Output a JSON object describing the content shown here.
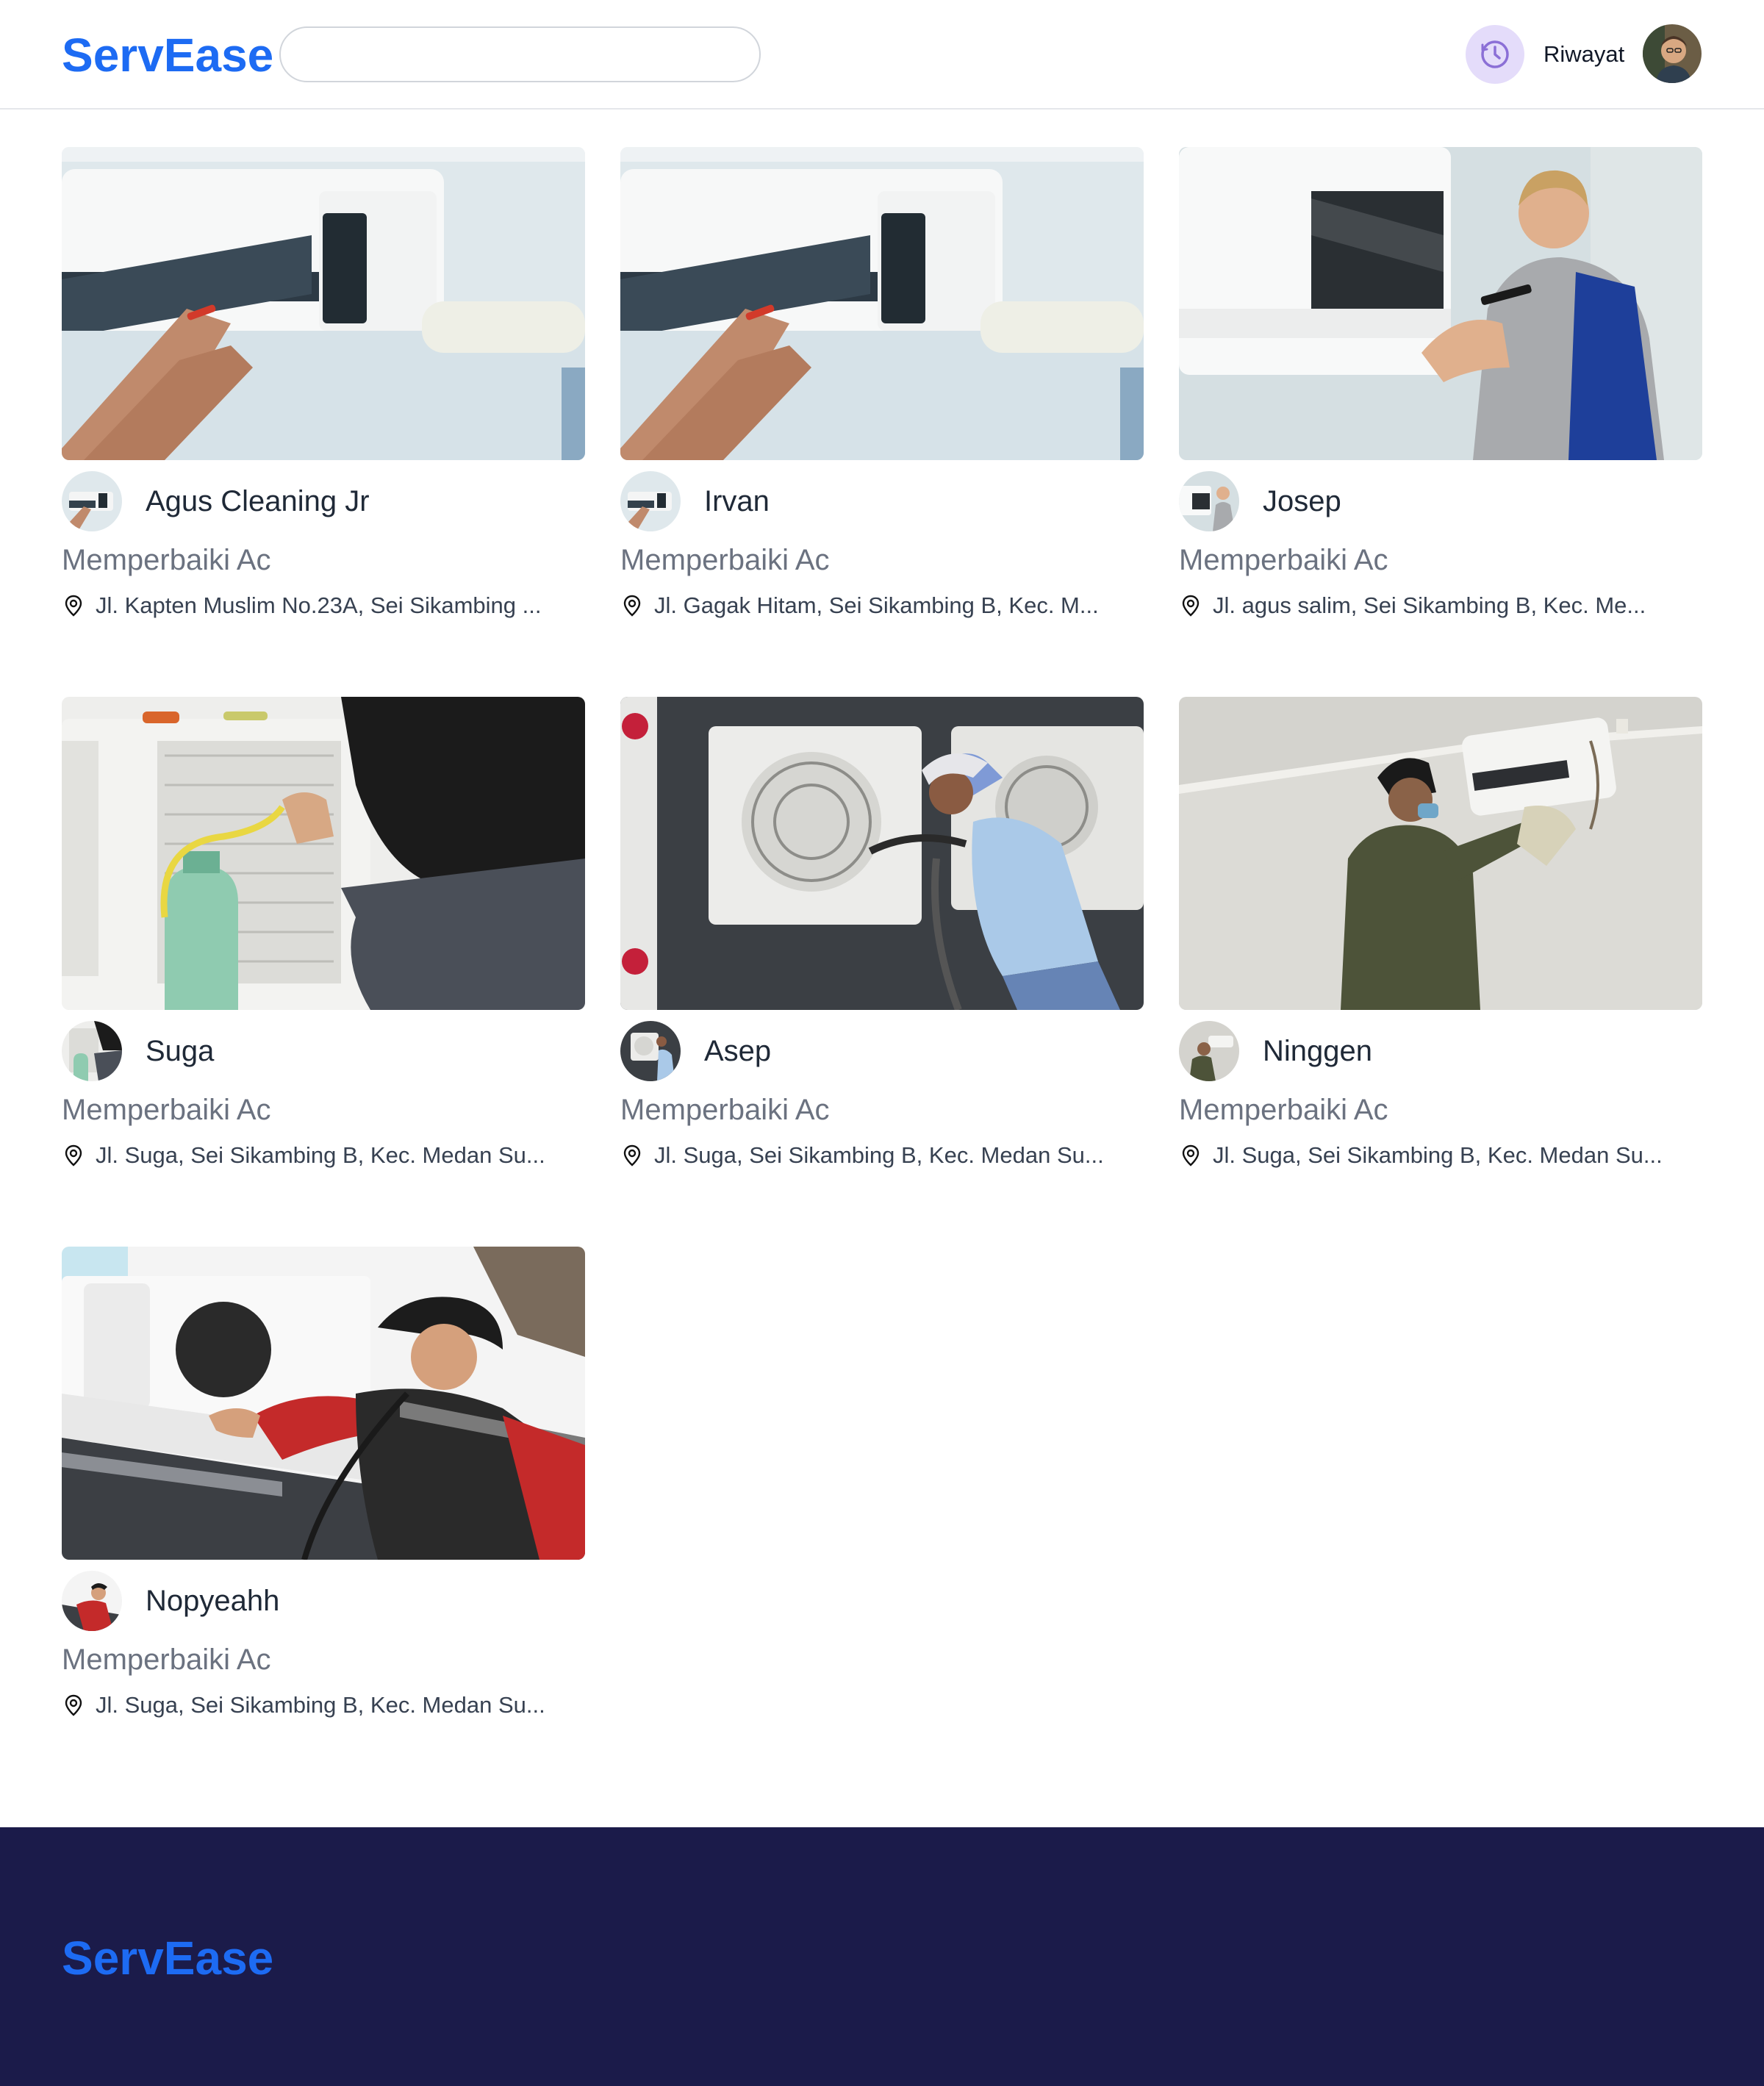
{
  "header": {
    "logo": "ServEase",
    "search": {
      "value": "",
      "placeholder": ""
    },
    "history_label": "Riwayat",
    "history_icon": "clock-icon",
    "avatar_icon": "user-avatar"
  },
  "providers": [
    {
      "name": "Agus Cleaning Jr",
      "service": "Memperbaiki Ac",
      "address": "Jl. Kapten Muslim No.23A, Sei Sikambing ...",
      "image": "ac-indoor-repair-photo"
    },
    {
      "name": "Irvan",
      "service": "Memperbaiki Ac",
      "address": "Jl. Gagak Hitam, Sei Sikambing B, Kec. M...",
      "image": "ac-indoor-repair-photo"
    },
    {
      "name": "Josep",
      "service": "Memperbaiki Ac",
      "address": "Jl. agus salim, Sei Sikambing B, Kec. Me...",
      "image": "technician-wall-ac-photo"
    },
    {
      "name": "Suga",
      "service": "Memperbaiki Ac",
      "address": "Jl. Suga, Sei Sikambing B, Kec. Medan Su...",
      "image": "outdoor-unit-refrigerant-photo"
    },
    {
      "name": "Asep",
      "service": "Memperbaiki Ac",
      "address": "Jl. Suga, Sei Sikambing B, Kec. Medan Su...",
      "image": "outdoor-unit-cleaning-photo"
    },
    {
      "name": "Ninggen",
      "service": "Memperbaiki Ac",
      "address": "Jl. Suga, Sei Sikambing B, Kec. Medan Su...",
      "image": "wall-ac-wiping-photo"
    },
    {
      "name": "Nopyeahh",
      "service": "Memperbaiki Ac",
      "address": "Jl. Suga, Sei Sikambing B, Kec. Medan Su...",
      "image": "ac-unit-servicing-photo"
    }
  ],
  "footer": {
    "logo": "ServEase"
  },
  "colors": {
    "brand": "#1d6bf3",
    "footer_bg": "#1b1b4a",
    "history_bg": "#e4dcfa",
    "muted": "#6b7280"
  }
}
